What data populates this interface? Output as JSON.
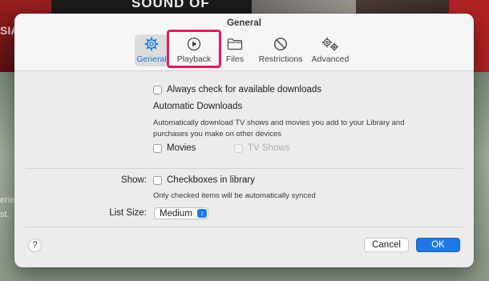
{
  "background": {
    "band_text": "SOUND OF METAL",
    "left_red_text": "SIA",
    "left_text_lines": [
      "erie",
      "st."
    ]
  },
  "window": {
    "title": "General"
  },
  "tabs": [
    {
      "label": "General",
      "icon": "gear-icon",
      "selected": true
    },
    {
      "label": "Playback",
      "icon": "play-circle-icon",
      "selected": false
    },
    {
      "label": "Files",
      "icon": "folder-icon",
      "selected": false
    },
    {
      "label": "Restrictions",
      "icon": "prohibited-icon",
      "selected": false
    },
    {
      "label": "Advanced",
      "icon": "gears-icon",
      "selected": false
    }
  ],
  "general": {
    "always_check_label": "Always check for available downloads",
    "auto_downloads_heading": "Automatic Downloads",
    "auto_downloads_desc_line1": "Automatically download TV shows and movies you add to your Library and",
    "auto_downloads_desc_line2": "purchases you make on other devices",
    "movies_label": "Movies",
    "tv_shows_label": "TV Shows",
    "show_label": "Show:",
    "checkboxes_label": "Checkboxes in library",
    "checkboxes_note": "Only checked items will be automatically synced",
    "list_size_label": "List Size:",
    "list_size_value": "Medium"
  },
  "footer": {
    "help_label": "?",
    "cancel_label": "Cancel",
    "ok_label": "OK"
  },
  "colors": {
    "accent": "#1e78e3",
    "highlight": "#e31b5e"
  }
}
